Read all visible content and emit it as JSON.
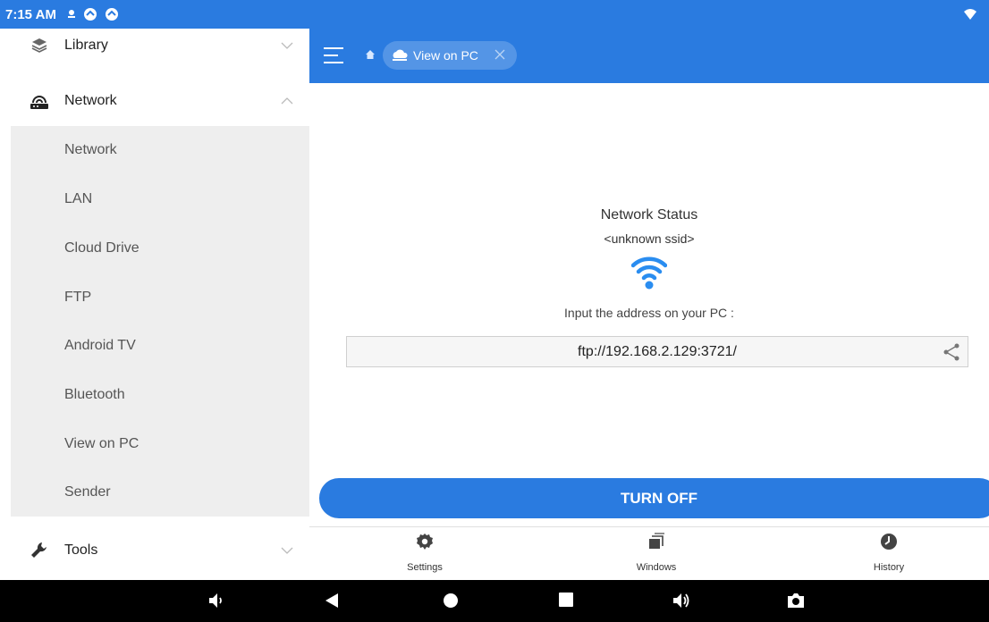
{
  "status_bar": {
    "time": "7:15 AM"
  },
  "sidebar": {
    "library": {
      "label": "Library"
    },
    "network": {
      "label": "Network"
    },
    "sub_items": [
      {
        "label": "Network"
      },
      {
        "label": "LAN"
      },
      {
        "label": "Cloud Drive"
      },
      {
        "label": "FTP"
      },
      {
        "label": "Android TV"
      },
      {
        "label": "Bluetooth"
      },
      {
        "label": "View on PC"
      },
      {
        "label": "Sender"
      }
    ],
    "tools": {
      "label": "Tools"
    }
  },
  "topbar": {
    "tab_label": "View on PC"
  },
  "main": {
    "title": "Network Status",
    "ssid": "<unknown ssid>",
    "instruction": "Input the address on your PC :",
    "address": "ftp://192.168.2.129:3721/",
    "turn_off": "TURN OFF"
  },
  "bottom_tabs": [
    {
      "label": "Settings",
      "icon": "gear-icon"
    },
    {
      "label": "Windows",
      "icon": "windows-stack-icon"
    },
    {
      "label": "History",
      "icon": "clock-icon"
    }
  ],
  "colors": {
    "accent": "#2a7be0",
    "sidebar_sub_bg": "#eeeeee",
    "wifi": "#2a8df0"
  }
}
